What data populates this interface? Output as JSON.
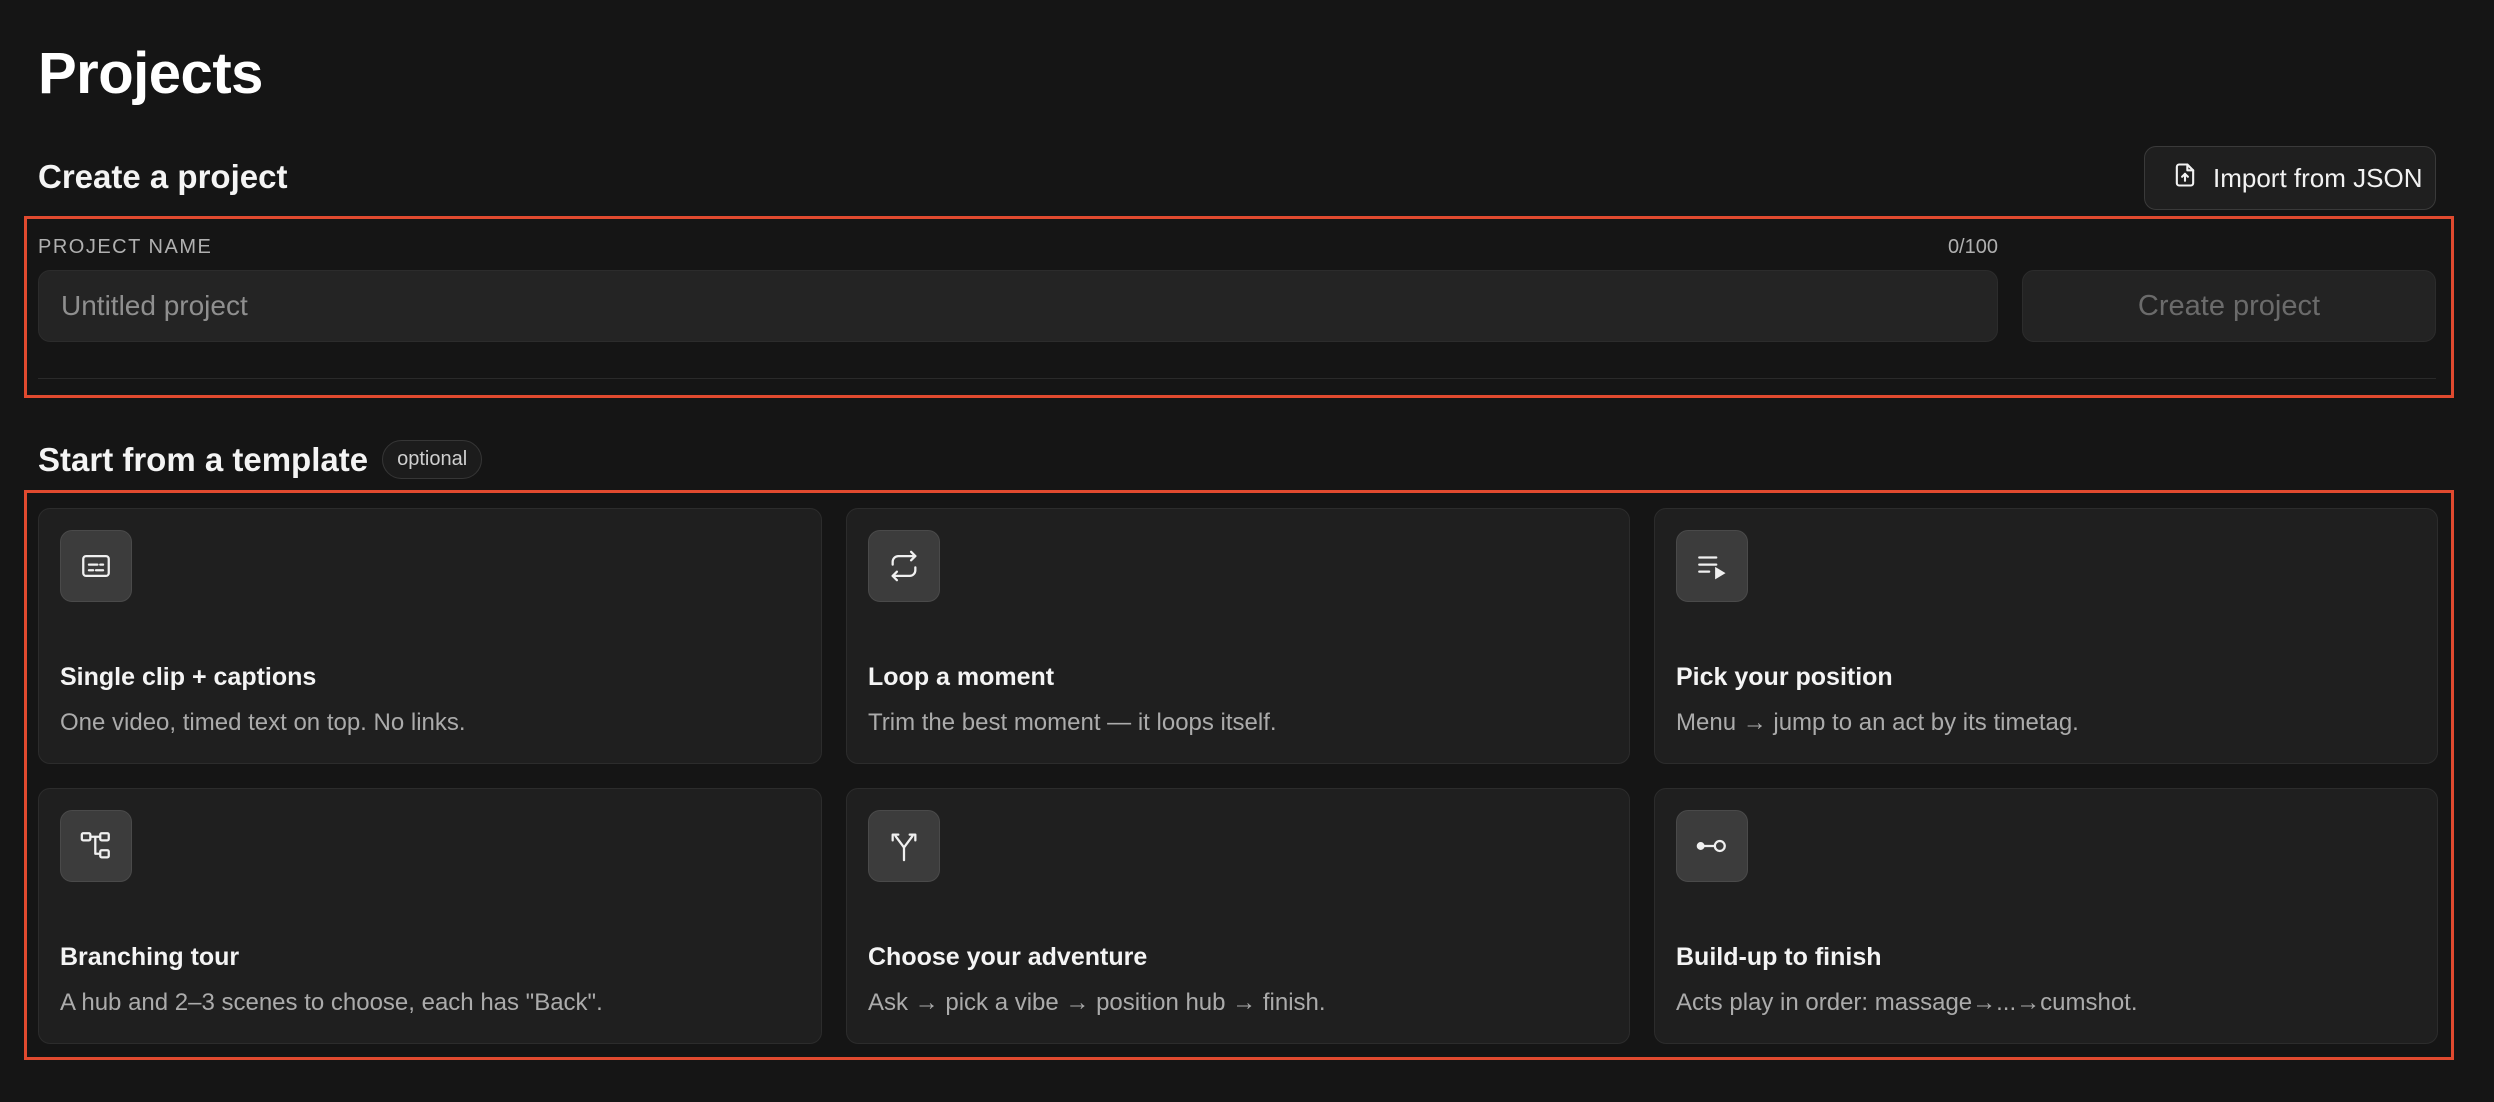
{
  "page_title": "Projects",
  "create": {
    "title": "Create a project",
    "import_label": "Import from JSON",
    "field_label": "PROJECT NAME",
    "char_count": "0/100",
    "name_value": "",
    "name_placeholder": "Untitled project",
    "create_label": "Create project"
  },
  "templates": {
    "title": "Start from a template",
    "badge": "optional",
    "items": [
      {
        "title": "Single clip + captions",
        "desc": "One video, timed text on top. No links.",
        "icon": "captions-icon"
      },
      {
        "title": "Loop a moment",
        "desc": "Trim the best moment — it loops itself.",
        "icon": "loop-icon"
      },
      {
        "title": "Pick your position",
        "desc": "Menu → jump to an act by its timetag.",
        "icon": "playlist-icon"
      },
      {
        "title": "Branching tour",
        "desc": "A hub and 2–3 scenes to choose, each has \"Back\".",
        "icon": "branch-tree-icon"
      },
      {
        "title": "Choose your adventure",
        "desc": "Ask → pick a vibe → position hub → finish.",
        "icon": "split-arrows-icon"
      },
      {
        "title": "Build-up to finish",
        "desc": "Acts play in order: massage→...→cumshot.",
        "icon": "commit-icon"
      }
    ]
  },
  "colors": {
    "background": "#151515",
    "accent_frame": "#e04a2f",
    "card": "#1f1f1f"
  }
}
